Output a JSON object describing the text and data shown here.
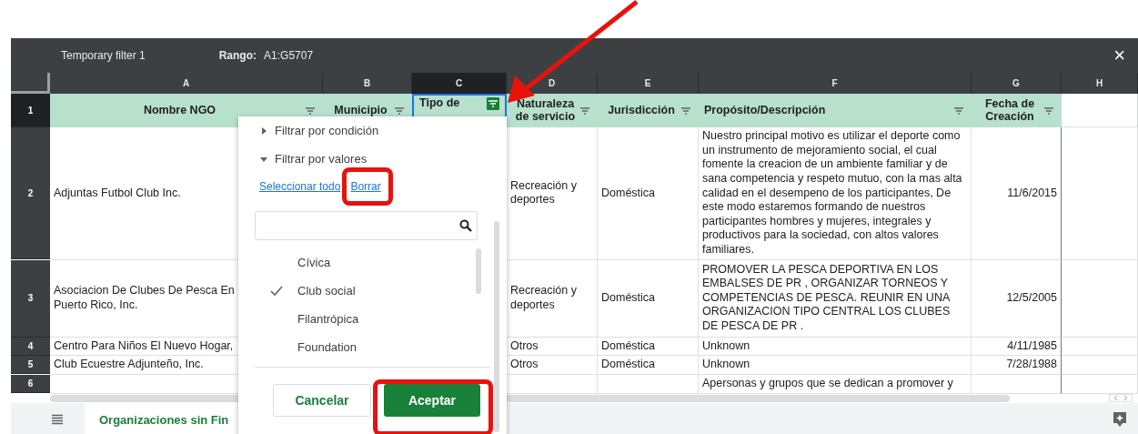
{
  "filter_bar": {
    "title": "Temporary filter 1",
    "range_label": "Rango:",
    "range_value": "A1:G5707",
    "close": "×"
  },
  "columns": [
    {
      "letter": "A",
      "selected": false
    },
    {
      "letter": "B",
      "selected": false
    },
    {
      "letter": "C",
      "selected": true
    },
    {
      "letter": "D",
      "selected": false
    },
    {
      "letter": "E",
      "selected": false
    },
    {
      "letter": "F",
      "selected": false
    },
    {
      "letter": "G",
      "selected": false
    },
    {
      "letter": "H",
      "selected": false
    }
  ],
  "header_row": {
    "number": "1",
    "cells": [
      {
        "text": "Nombre NGO",
        "filter_active": false
      },
      {
        "text": "Municipio",
        "filter_active": false
      },
      {
        "text": "Tipo de",
        "filter_active": true
      },
      {
        "text": "Naturaleza de servicio",
        "filter_active": false
      },
      {
        "text": "Jurisdicción",
        "filter_active": false
      },
      {
        "text": "Propósito/Descripción",
        "filter_active": false
      },
      {
        "text": "Fecha de Creación",
        "filter_active": false
      }
    ]
  },
  "rows": [
    {
      "number": "2",
      "nombre": "Adjuntas Futbol Club Inc.",
      "naturaleza": "Recreación y deportes",
      "jurisdiccion": "Doméstica",
      "proposito": "Nuestro principal motivo es utilizar el deporte como un instrumento de mejoramiento social, el cual fomente la creacion de un ambiente familiar y de sana competencia y respeto mutuo, con la mas alta calidad en el desempeno de los participantes, De este modo estaremos formando de nuestros participantes hombres y mujeres, integrales y productivos para la sociedad, con altos valores familiares.",
      "fecha": "11/6/2015"
    },
    {
      "number": "3",
      "nombre": "Asociacion De Clubes De Pesca En Puerto Rico, Inc.",
      "naturaleza": "Recreación y deportes",
      "jurisdiccion": "Doméstica",
      "proposito": "PROMOVER  LA PESCA DEPORTIVA EN LOS EMBALSES DE PR , ORGANIZAR TORNEOS Y COMPETENCIAS DE PESCA. REUNIR  EN UNA ORGANIZACION TIPO CENTRAL LOS CLUBES DE PESCA DE PR .",
      "fecha": "12/5/2005"
    },
    {
      "number": "4",
      "nombre": "Centro Para Niños El Nuevo Hogar,",
      "naturaleza": "Otros",
      "jurisdiccion": "Doméstica",
      "proposito": "Unknown",
      "fecha": "4/11/1985"
    },
    {
      "number": "5",
      "nombre": "Club Ecuestre Adjunteño, Inc.",
      "naturaleza": "Otros",
      "jurisdiccion": "Doméstica",
      "proposito": "Unknown",
      "fecha": "7/28/1988"
    },
    {
      "number": "6",
      "proposito": "Apersonas y grupos que se dedican a promover y"
    }
  ],
  "filter_menu": {
    "sections": [
      {
        "label": "Filtrar por condición",
        "expanded": false
      },
      {
        "label": "Filtrar por valores",
        "expanded": true
      }
    ],
    "links": [
      "Seleccionar todo",
      "Borrar"
    ],
    "values": [
      {
        "label": "Cívica",
        "selected": false
      },
      {
        "label": "Club social",
        "selected": true
      },
      {
        "label": "Filantrópica",
        "selected": false
      },
      {
        "label": "Foundation",
        "selected": false
      }
    ],
    "buttons": [
      {
        "label": "Cancelar",
        "kind": "secondary"
      },
      {
        "label": "Aceptar",
        "kind": "primary"
      }
    ]
  },
  "sheet_tabs": [
    {
      "label": "Organizaciones sin Fin",
      "selected": true
    }
  ]
}
